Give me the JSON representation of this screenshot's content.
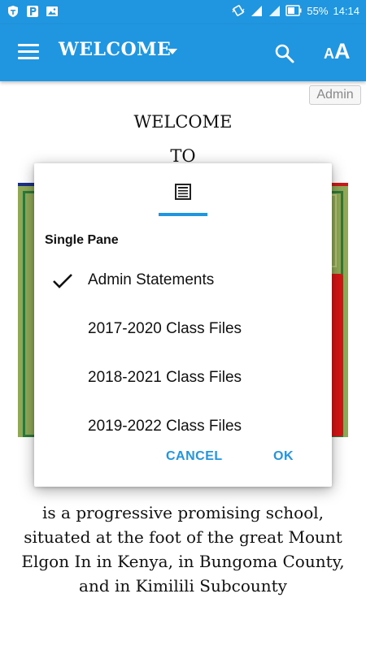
{
  "status_bar": {
    "battery": "55%",
    "time": "14:14"
  },
  "app_bar": {
    "title": "WELCOME",
    "font_small": "A",
    "font_big": "A"
  },
  "page": {
    "admin_badge": "Admin",
    "welcome": "WELCOME",
    "to": "TO",
    "description": "is a progressive promising school, situated at the foot of the great Mount Elgon In in Kenya, in Bungoma County, and in Kimilili Subcounty"
  },
  "dialog": {
    "subtitle": "Single Pane",
    "options": [
      {
        "label": "Admin Statements",
        "checked": true
      },
      {
        "label": "2017-2020 Class Files",
        "checked": false
      },
      {
        "label": "2018-2021 Class Files",
        "checked": false
      },
      {
        "label": "2019-2022 Class Files",
        "checked": false
      }
    ],
    "cancel": "CANCEL",
    "ok": "OK"
  },
  "colors": {
    "accent": "#2196e0",
    "image_green": "#91aa58",
    "image_red": "#d61616"
  }
}
